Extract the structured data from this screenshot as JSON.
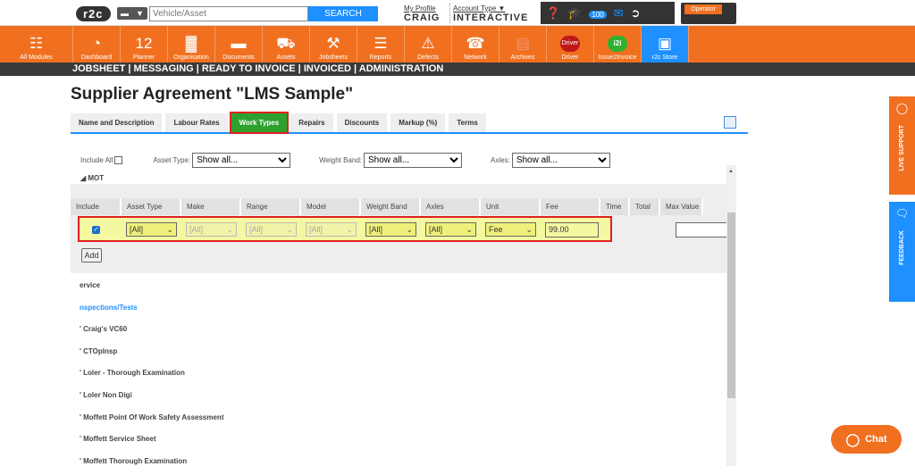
{
  "top": {
    "logo": "r2c",
    "vehicle_placeholder": "Vehicle/Asset",
    "search_label": "SEARCH",
    "profile_link": "My Profile",
    "profile_name": "CRAIG",
    "account_type_link": "Account Type ▼",
    "account_type_value": "INTERACTIVE",
    "notification_count": "100",
    "operator_label": "Operator"
  },
  "nav": [
    {
      "label": "All Modules",
      "icon": "grid-icon",
      "glyph": "☷"
    },
    {
      "label": "Dashboard",
      "icon": "dashboard-icon",
      "glyph": "◔"
    },
    {
      "label": "Planner",
      "icon": "calendar-icon",
      "glyph": "12"
    },
    {
      "label": "Organisation",
      "icon": "organisation-icon",
      "glyph": "▓"
    },
    {
      "label": "Documents",
      "icon": "folder-icon",
      "glyph": "▬"
    },
    {
      "label": "Assets",
      "icon": "truck-icon",
      "glyph": "⛟"
    },
    {
      "label": "Jobsheets",
      "icon": "tools-icon",
      "glyph": "⚒"
    },
    {
      "label": "Reports",
      "icon": "clipboard-icon",
      "glyph": "☰"
    },
    {
      "label": "Defects",
      "icon": "warning-icon",
      "glyph": "⚠"
    },
    {
      "label": "Network",
      "icon": "network-icon",
      "glyph": "☎"
    },
    {
      "label": "Archives",
      "icon": "archive-icon",
      "glyph": "▤"
    },
    {
      "label": "Driver",
      "icon": "driver-icon",
      "glyph": "Driver"
    },
    {
      "label": "Issue2Invoice",
      "icon": "i2i-icon",
      "glyph": "i2i"
    },
    {
      "label": "r2c Store",
      "icon": "store-icon",
      "glyph": "▣"
    }
  ],
  "subnav": "JOBSHEET  |  MESSAGING  |  READY TO INVOICE  |  INVOICED  |  ADMINISTRATION",
  "page_title": "Supplier Agreement \"LMS Sample\"",
  "tabs": [
    "Name and Description",
    "Labour Rates",
    "Work Types",
    "Repairs",
    "Discounts",
    "Markup (%)",
    "Terms"
  ],
  "filters": {
    "include_all": "Include All",
    "asset_type_label": "Asset Type:",
    "asset_type_value": "Show all...",
    "weight_band_label": "Weight Band:",
    "weight_band_value": "Show all...",
    "axles_label": "Axles:",
    "axles_value": "Show all..."
  },
  "section": "MOT",
  "columns": [
    "Include",
    "Asset Type",
    "Make",
    "Range",
    "Model",
    "Weight Band",
    "Axles",
    "Unit",
    "Fee",
    "Time",
    "Total",
    "Max Value"
  ],
  "row": {
    "asset_type": "[All]",
    "make": "[All]",
    "range": "[All]",
    "model": "[All]",
    "weight_band": "[All]",
    "axles": "[All]",
    "unit": "Fee",
    "fee": "99.00"
  },
  "add_label": "Add",
  "work_types": [
    {
      "label": "ervice",
      "blue": false
    },
    {
      "label": "nspections/Tests",
      "blue": true
    },
    {
      "label": "' Craig's VC60",
      "blue": false
    },
    {
      "label": "' CTOpInsp",
      "blue": false
    },
    {
      "label": "' Loler - Thorough Examination",
      "blue": false
    },
    {
      "label": "' Loler Non Digi",
      "blue": false
    },
    {
      "label": "' Moffett Point Of Work Safety Assessment",
      "blue": false
    },
    {
      "label": "' Moffett Service Sheet",
      "blue": false
    },
    {
      "label": "' Moffett Thorough Examination",
      "blue": false
    }
  ],
  "side": {
    "live_support": "LIVE SUPPORT",
    "feedback": "FEEDBACK"
  },
  "chat_label": "Chat",
  "colors": {
    "brand_orange": "#f07020",
    "accent_blue": "#1e90ff",
    "active_tab": "#2ea02e",
    "highlight_red": "#e02020"
  }
}
